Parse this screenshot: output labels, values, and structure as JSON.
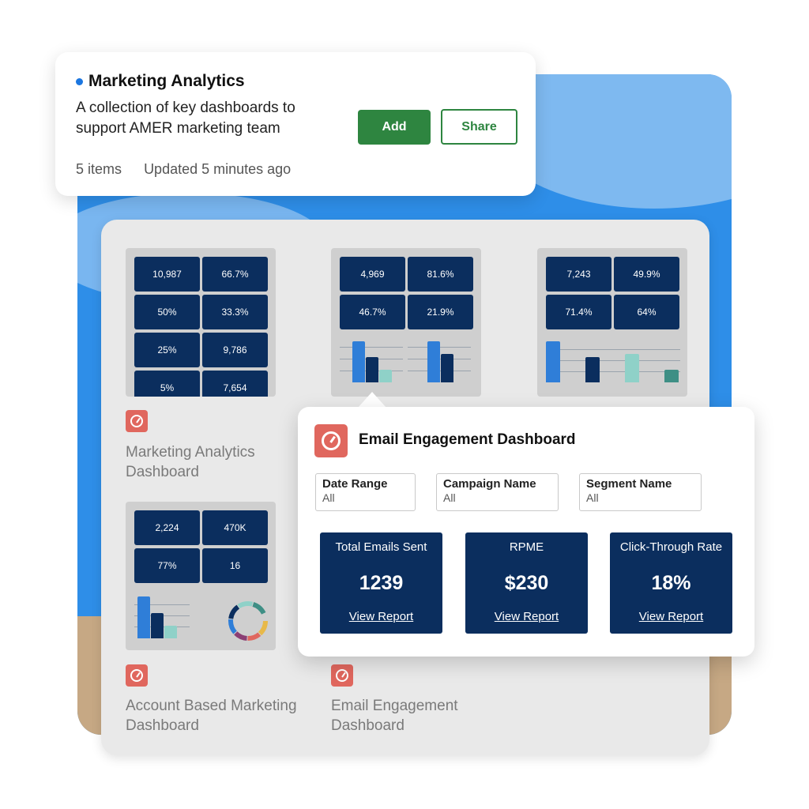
{
  "card": {
    "title": "Marketing Analytics",
    "description": "A collection of key dashboards to support AMER marketing team",
    "items_count": "5 items",
    "updated": "Updated 5 minutes ago",
    "add_label": "Add",
    "share_label": "Share"
  },
  "thumbs": {
    "t1": [
      "10,987",
      "66.7%",
      "50%",
      "33.3%",
      "25%",
      "9,786",
      "5%",
      "7,654"
    ],
    "t2": [
      "4,969",
      "81.6%",
      "46.7%",
      "21.9%"
    ],
    "t3": [
      "7,243",
      "49.9%",
      "71.4%",
      "64%"
    ],
    "t4": [
      "2,224",
      "470K",
      "77%",
      "16"
    ]
  },
  "dashboards": {
    "d1": "Marketing Analytics Dashboard",
    "d2": "Account Based Marketing Dashboard",
    "d3": "Email Engagement Dashboard"
  },
  "popup": {
    "title": "Email Engagement Dashboard",
    "filters": [
      {
        "label": "Date Range",
        "value": "All"
      },
      {
        "label": "Campaign Name",
        "value": "All"
      },
      {
        "label": "Segment Name",
        "value": "All"
      }
    ],
    "kpis": [
      {
        "label": "Total Emails Sent",
        "value": "1239",
        "link": "View Report"
      },
      {
        "label": "RPME",
        "value": "$230",
        "link": "View Report"
      },
      {
        "label": "Click-Through Rate",
        "value": "18%",
        "link": "View Report"
      }
    ]
  },
  "colors": {
    "accent_green": "#2e8540",
    "tile_navy": "#0b2e5e",
    "dashboard_icon": "#e0675e",
    "bar_blue": "#2f7ed8",
    "bar_teal": "#8fd1c8"
  },
  "icons": [
    "status-dot-icon",
    "dashboard-gauge-icon"
  ]
}
